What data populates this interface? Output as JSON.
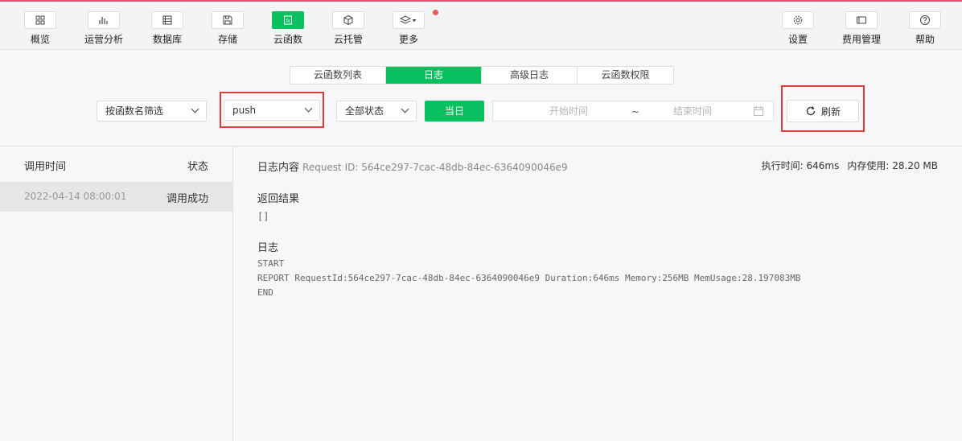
{
  "toolbar": {
    "left": [
      {
        "label": "概览",
        "icon": "grid-icon"
      },
      {
        "label": "运营分析",
        "icon": "bar-chart-icon"
      },
      {
        "label": "数据库",
        "icon": "database-icon"
      },
      {
        "label": "存储",
        "icon": "floppy-icon"
      },
      {
        "label": "云函数",
        "icon": "function-icon",
        "active": true
      },
      {
        "label": "云托管",
        "icon": "cube-icon"
      },
      {
        "label": "更多",
        "icon": "layers-icon"
      }
    ],
    "right": [
      {
        "label": "设置",
        "icon": "gear-icon"
      },
      {
        "label": "费用管理",
        "icon": "billing-icon"
      },
      {
        "label": "帮助",
        "icon": "help-icon"
      }
    ]
  },
  "tabs": [
    "云函数列表",
    "日志",
    "高级日志",
    "云函数权限"
  ],
  "active_tab": "日志",
  "filters": {
    "filter_mode": "按函数名筛选",
    "function_name": "push",
    "status": "全部状态",
    "today_label": "当日",
    "start_placeholder": "开始时间",
    "range_sep": "~",
    "end_placeholder": "结束时间",
    "refresh_label": "刷新"
  },
  "list": {
    "col_time": "调用时间",
    "col_status": "状态",
    "rows": [
      {
        "time": "2022-04-14 08:00:01",
        "status": "调用成功"
      }
    ]
  },
  "detail": {
    "title": "日志内容",
    "request_id": "Request ID: 564ce297-7cac-48db-84ec-6364090046e9",
    "exec_time": "执行时间: 646ms",
    "mem_usage": "内存使用: 28.20 MB",
    "result_label": "返回结果",
    "result_value": "[]",
    "log_label": "日志",
    "log_lines": [
      "START",
      "REPORT RequestId:564ce297-7cac-48db-84ec-6364090046e9 Duration:646ms Memory:256MB MemUsage:28.197083MB",
      "END"
    ]
  },
  "colors": {
    "accent": "#07c160",
    "highlight": "#e23a3a",
    "notify_dot": "#f05a5a"
  }
}
